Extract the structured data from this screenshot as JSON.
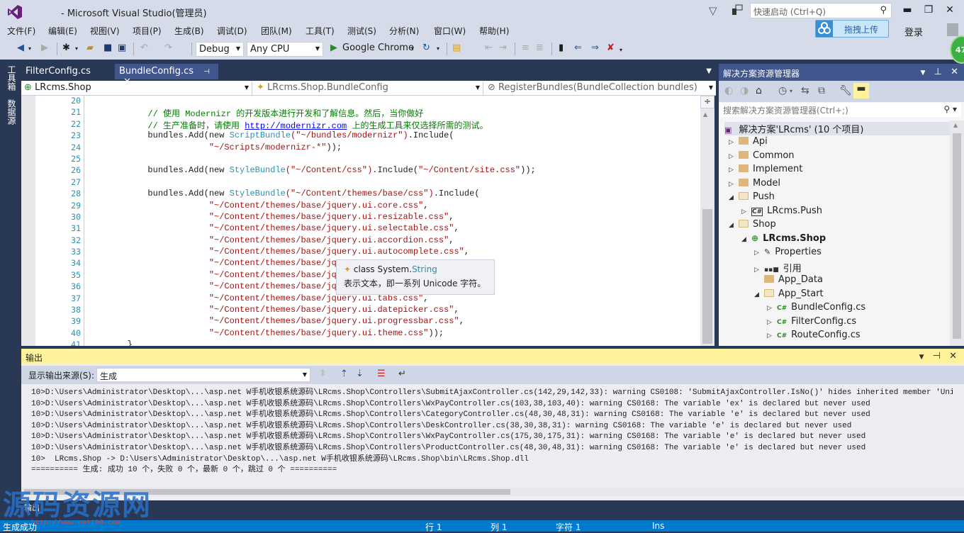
{
  "window": {
    "title": "- Microsoft Visual Studio(管理员)",
    "quick_launch_placeholder": "快速启动 (Ctrl+Q)",
    "upload_label": "拖拽上传",
    "login_label": "登录",
    "badge_text": "47"
  },
  "menu": [
    "文件(F)",
    "编辑(E)",
    "视图(V)",
    "项目(P)",
    "生成(B)",
    "调试(D)",
    "团队(M)",
    "工具(T)",
    "测试(S)",
    "分析(N)",
    "窗口(W)",
    "帮助(H)"
  ],
  "toolbar": {
    "configuration": "Debug",
    "platform": "Any CPU",
    "run_target": "Google Chrome"
  },
  "left_rail": [
    "工具箱",
    "数据源"
  ],
  "tabs": [
    {
      "label": "FilterConfig.cs",
      "active": false
    },
    {
      "label": "BundleConfig.cs",
      "active": true
    }
  ],
  "navbar": {
    "project": "LRcms.Shop",
    "class": "LRcms.Shop.BundleConfig",
    "member": "RegisterBundles(BundleCollection bundles)"
  },
  "editor": {
    "line_numbers": [
      "20",
      "21",
      "22",
      "23",
      "24",
      "25",
      "26",
      "27",
      "28",
      "29",
      "30",
      "31",
      "32",
      "33",
      "34",
      "35",
      "36",
      "37",
      "38",
      "39",
      "40",
      "41"
    ],
    "lines": [
      {
        "indent": "",
        "parts": []
      },
      {
        "indent": "            ",
        "parts": [
          {
            "t": "cm",
            "v": "// 使用 Modernizr 的开发版本进行开发和了解信息。然后，当你做好"
          }
        ]
      },
      {
        "indent": "            ",
        "parts": [
          {
            "t": "cm",
            "v": "// 生产准备时，请使用 "
          },
          {
            "t": "ul",
            "v": "http://modernizr.com"
          },
          {
            "t": "cm",
            "v": " 上的生成工具来仅选择所需的测试。"
          }
        ]
      },
      {
        "indent": "            ",
        "parts": [
          {
            "t": "",
            "v": "bundles.Add(new "
          },
          {
            "t": "ty",
            "v": "ScriptBundle"
          },
          {
            "t": "st",
            "v": "(\"~/bundles/modernizr\")"
          },
          {
            "t": "",
            "v": ".Include("
          }
        ]
      },
      {
        "indent": "                        ",
        "parts": [
          {
            "t": "st",
            "v": "\"~/Scripts/modernizr-*\""
          },
          {
            "t": "",
            "v": "));"
          }
        ]
      },
      {
        "indent": "",
        "parts": []
      },
      {
        "indent": "            ",
        "parts": [
          {
            "t": "",
            "v": "bundles.Add(new "
          },
          {
            "t": "ty",
            "v": "StyleBundle"
          },
          {
            "t": "st",
            "v": "(\"~/Content/css\")"
          },
          {
            "t": "",
            "v": ".Include("
          },
          {
            "t": "st",
            "v": "\"~/Content/site.css\""
          },
          {
            "t": "",
            "v": "));"
          }
        ]
      },
      {
        "indent": "",
        "parts": []
      },
      {
        "indent": "            ",
        "parts": [
          {
            "t": "",
            "v": "bundles.Add(new "
          },
          {
            "t": "ty",
            "v": "StyleBundle"
          },
          {
            "t": "st",
            "v": "(\"~/Content/themes/base/css\")"
          },
          {
            "t": "",
            "v": ".Include("
          }
        ]
      },
      {
        "indent": "                        ",
        "parts": [
          {
            "t": "st",
            "v": "\"~/Content/themes/base/jquery.ui.core.css\""
          },
          {
            "t": "",
            "v": ","
          }
        ]
      },
      {
        "indent": "                        ",
        "parts": [
          {
            "t": "st",
            "v": "\"~/Content/themes/base/jquery.ui.resizable.css\""
          },
          {
            "t": "",
            "v": ","
          }
        ]
      },
      {
        "indent": "                        ",
        "parts": [
          {
            "t": "st",
            "v": "\"~/Content/themes/base/jquery.ui.selectable.css\""
          },
          {
            "t": "",
            "v": ","
          }
        ]
      },
      {
        "indent": "                        ",
        "parts": [
          {
            "t": "st",
            "v": "\"~/Content/themes/base/jquery.ui.accordion.css\""
          },
          {
            "t": "",
            "v": ","
          }
        ]
      },
      {
        "indent": "                        ",
        "parts": [
          {
            "t": "st",
            "v": "\"~/Content/themes/base/jquery.ui.autocomplete.css\""
          },
          {
            "t": "",
            "v": ","
          }
        ]
      },
      {
        "indent": "                        ",
        "parts": [
          {
            "t": "st",
            "v": "\"~/Content/themes/base/jqu"
          }
        ]
      },
      {
        "indent": "                        ",
        "parts": [
          {
            "t": "st",
            "v": "\"~/Content/themes/base/jqu"
          }
        ]
      },
      {
        "indent": "                        ",
        "parts": [
          {
            "t": "st",
            "v": "\"~/Content/themes/base/jqu"
          }
        ]
      },
      {
        "indent": "                        ",
        "parts": [
          {
            "t": "st",
            "v": "\"~/Content/themes/base/jquery.ui.tabs.css\""
          },
          {
            "t": "",
            "v": ","
          }
        ]
      },
      {
        "indent": "                        ",
        "parts": [
          {
            "t": "st",
            "v": "\"~/Content/themes/base/jquery.ui.datepicker.css\""
          },
          {
            "t": "",
            "v": ","
          }
        ]
      },
      {
        "indent": "                        ",
        "parts": [
          {
            "t": "st",
            "v": "\"~/Content/themes/base/jquery.ui.progressbar.css\""
          },
          {
            "t": "",
            "v": ","
          }
        ]
      },
      {
        "indent": "                        ",
        "parts": [
          {
            "t": "st",
            "v": "\"~/Content/themes/base/jquery.ui.theme.css\""
          },
          {
            "t": "",
            "v": "));"
          }
        ]
      },
      {
        "indent": "        ",
        "parts": [
          {
            "t": "",
            "v": "}"
          }
        ]
      }
    ]
  },
  "tooltip": {
    "keyword": "class System.",
    "type": "String",
    "description": "表示文本，即一系列 Unicode 字符。"
  },
  "solution_explorer": {
    "title": "解决方案资源管理器",
    "search_placeholder": "搜索解决方案资源管理器(Ctrl+;)",
    "root": "解决方案'LRcms' (10 个项目)",
    "items": [
      {
        "label": "Api",
        "level": 0,
        "expander": "▷",
        "icon": "folder"
      },
      {
        "label": "Common",
        "level": 0,
        "expander": "▷",
        "icon": "folder"
      },
      {
        "label": "Implement",
        "level": 0,
        "expander": "▷",
        "icon": "folder"
      },
      {
        "label": "Model",
        "level": 0,
        "expander": "▷",
        "icon": "folder"
      },
      {
        "label": "Push",
        "level": 0,
        "expander": "◢",
        "icon": "folder-open"
      },
      {
        "label": "LRcms.Push",
        "level": 1,
        "expander": "▷",
        "icon": "csproj"
      },
      {
        "label": "Shop",
        "level": 0,
        "expander": "◢",
        "icon": "folder-open"
      },
      {
        "label": "LRcms.Shop",
        "level": 1,
        "expander": "◢",
        "icon": "webproj",
        "bold": true
      },
      {
        "label": "Properties",
        "level": 2,
        "expander": "▷",
        "icon": "wrench"
      },
      {
        "label": "引用",
        "level": 2,
        "expander": "▷",
        "icon": "references"
      },
      {
        "label": "App_Data",
        "level": 2,
        "expander": "",
        "icon": "folder"
      },
      {
        "label": "App_Start",
        "level": 2,
        "expander": "◢",
        "icon": "folder-open"
      },
      {
        "label": "BundleConfig.cs",
        "level": 3,
        "expander": "▷",
        "icon": "cs-file"
      },
      {
        "label": "FilterConfig.cs",
        "level": 3,
        "expander": "▷",
        "icon": "cs-file"
      },
      {
        "label": "RouteConfig.cs",
        "level": 3,
        "expander": "▷",
        "icon": "cs-file"
      }
    ]
  },
  "output": {
    "title": "输出",
    "source_label": "显示输出来源(S):",
    "source_value": "生成",
    "lines": [
      "10>D:\\Users\\Administrator\\Desktop\\...\\asp.net W手机收银系统源码\\LRcms.Shop\\Controllers\\SubmitAjaxController.cs(142,29,142,33): warning CS0108: 'SubmitAjaxController.IsNo()' hides inherited member 'Unit",
      "10>D:\\Users\\Administrator\\Desktop\\...\\asp.net W手机收银系统源码\\LRcms.Shop\\Controllers\\WxPayController.cs(103,38,103,40): warning CS0168: The variable 'ex' is declared but never used",
      "10>D:\\Users\\Administrator\\Desktop\\...\\asp.net W手机收银系统源码\\LRcms.Shop\\Controllers\\CategoryController.cs(48,30,48,31): warning CS0168: The variable 'e' is declared but never used",
      "10>D:\\Users\\Administrator\\Desktop\\...\\asp.net W手机收银系统源码\\LRcms.Shop\\Controllers\\DeskController.cs(38,30,38,31): warning CS0168: The variable 'e' is declared but never used",
      "10>D:\\Users\\Administrator\\Desktop\\...\\asp.net W手机收银系统源码\\LRcms.Shop\\Controllers\\WxPayController.cs(175,30,175,31): warning CS0168: The variable 'e' is declared but never used",
      "10>D:\\Users\\Administrator\\Desktop\\...\\asp.net W手机收银系统源码\\LRcms.Shop\\Controllers\\ProductController.cs(48,30,48,31): warning CS0168: The variable 'e' is declared but never used",
      "10>  LRcms.Shop -> D:\\Users\\Administrator\\Desktop\\...\\asp.net W手机收银系统源码\\LRcms.Shop\\bin\\LRcms.Shop.dll",
      "========== 生成: 成功 10 个，失败 0 个，最新 0 个，跳过 0 个 =========="
    ],
    "bottom_tab": "输出"
  },
  "watermark": {
    "text": "源码资源网",
    "url": "http://www.net188.com"
  },
  "statusbar": {
    "message": "生成成功",
    "line": "行 1",
    "col": "列 1",
    "char": "字符 1",
    "mode": "Ins"
  }
}
